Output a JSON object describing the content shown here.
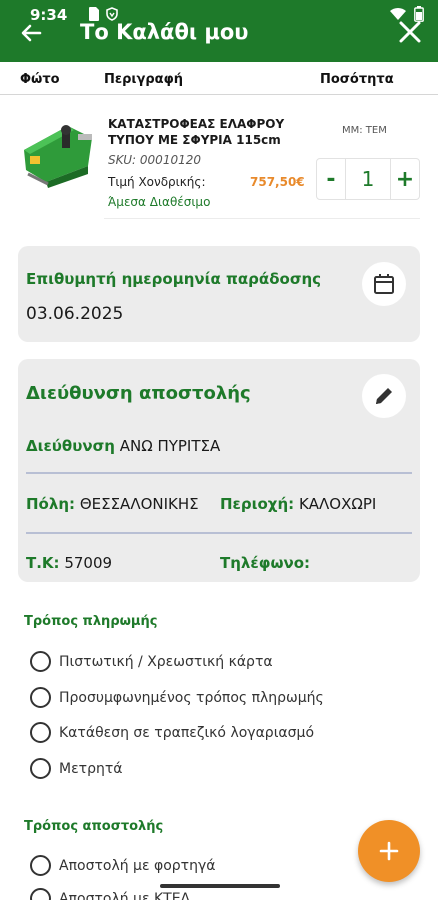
{
  "status_bar": {
    "time": "9:34"
  },
  "app_bar": {
    "title": "Το Καλάθι μου"
  },
  "table_header": {
    "photo": "Φώτο",
    "description": "Περιγραφή",
    "quantity": "Ποσότητα"
  },
  "product": {
    "name": "ΚΑΤΑΣΤΡΟΦΕΑΣ ΕΛΑΦΡΟΥ ΤΥΠΟΥ ΜΕ ΣΦΥΡΙΑ 115cm",
    "sku": "SKU: 00010120",
    "price_label": "Τιμή Χονδρικής:",
    "price": "757,50€",
    "availability": "Άμεσα Διαθέσιμο",
    "unit": "ΜΜ: ΤΕΜ",
    "quantity": "1",
    "minus_label": "-",
    "plus_label": "+"
  },
  "delivery_date": {
    "title": "Επιθυμητή ημερομηνία παράδοσης",
    "value": "03.06.2025"
  },
  "shipping_address": {
    "title": "Διεύθυνση αποστολής",
    "address_label": "Διεύθυνση",
    "address_value": "ΑΝΩ ΠΥΡΙΤΣΑ",
    "city_label": "Πόλη:",
    "city_value": "ΘΕΣΣΑΛΟΝΙΚΗΣ",
    "area_label": "Περιοχή:",
    "area_value": "ΚΑΛΟΧΩΡΙ",
    "zip_label": "Τ.Κ:",
    "zip_value": "57009",
    "phone_label": "Τηλέφωνο:"
  },
  "payment": {
    "title": "Τρόπος πληρωμής",
    "options": [
      "Πιστωτική / Χρεωστική κάρτα",
      "Προσυμφωνημένος τρόπος πληρωμής",
      "Κατάθεση σε τραπεζικό λογαριασμό",
      "Μετρητά"
    ]
  },
  "shipping_method": {
    "title": "Τρόπος αποστολής",
    "options": [
      "Αποστολή με φορτηγά",
      "Αποστολή με ΚΤΕΛ"
    ]
  },
  "icons": {
    "back": "arrow-left-icon",
    "close": "close-icon",
    "calendar": "calendar-icon",
    "edit": "pencil-icon",
    "fab": "plus-icon"
  },
  "colors": {
    "primary": "#1e7a2a",
    "accent": "#f09027",
    "price": "#e88a2c",
    "card_bg": "#ececec"
  }
}
